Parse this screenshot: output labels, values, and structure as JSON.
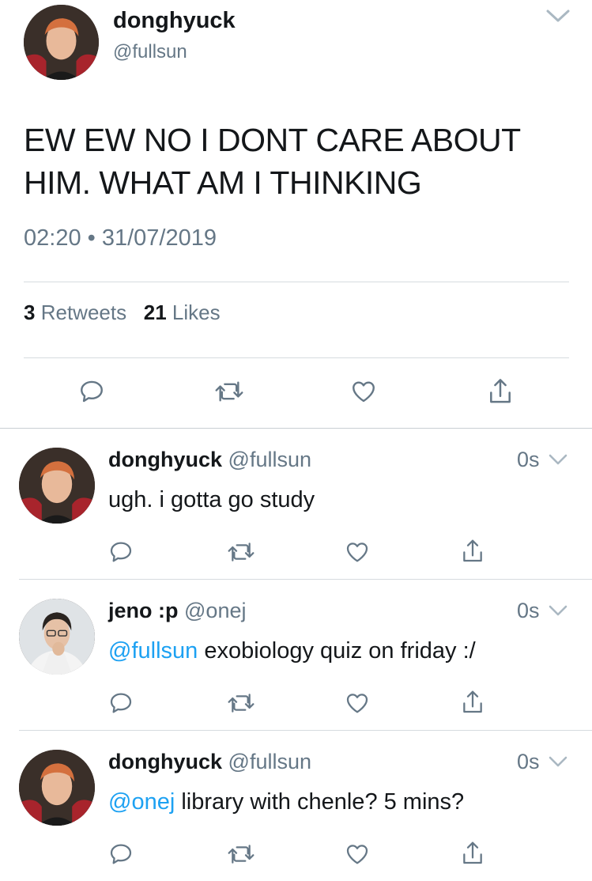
{
  "main_tweet": {
    "author_name": "donghyuck",
    "author_handle": "@fullsun",
    "text": "EW EW NO I DONT CARE ABOUT HIM. WHAT AM I THINKING",
    "timestamp": "02:20 • 31/07/2019",
    "retweets_count": "3",
    "retweets_label": "Retweets",
    "likes_count": "21",
    "likes_label": "Likes"
  },
  "replies": [
    {
      "author_name": "donghyuck",
      "author_handle": "@fullsun",
      "time": "0s",
      "mention": "",
      "text": "ugh. i gotta go study"
    },
    {
      "author_name": "jeno :p",
      "author_handle": "@onej",
      "time": "0s",
      "mention": "@fullsun",
      "text": " exobiology quiz on friday :/"
    },
    {
      "author_name": "donghyuck",
      "author_handle": "@fullsun",
      "time": "0s",
      "mention": "@onej",
      "text": " library with chenle? 5 mins?"
    }
  ],
  "icons": [
    "reply-icon",
    "retweet-icon",
    "like-icon",
    "share-icon",
    "chevron-down-icon"
  ],
  "colors": {
    "accent": "#1da1f2",
    "secondary_text": "#657786",
    "primary_text": "#14171a",
    "divider": "#d6dbdf"
  }
}
